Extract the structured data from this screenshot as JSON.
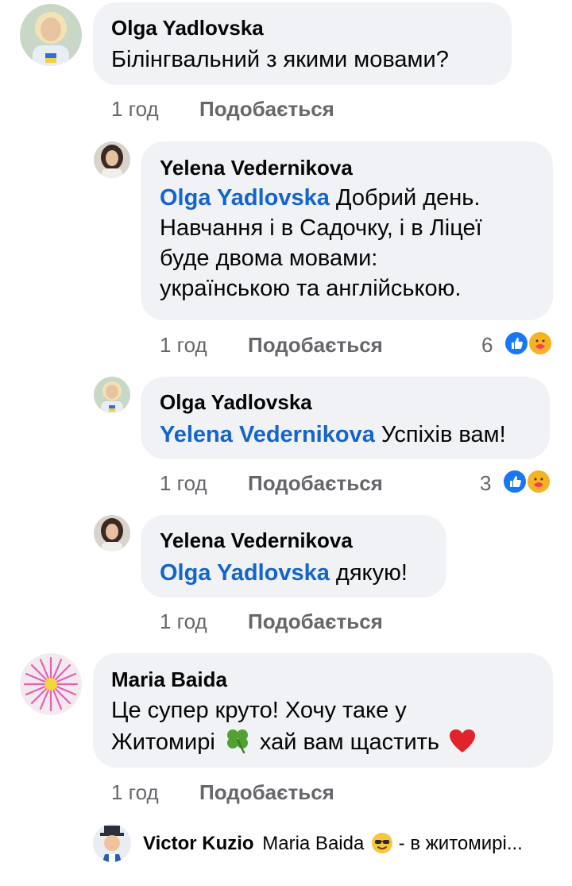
{
  "comments": [
    {
      "author": "Olga  Yadlovska",
      "text": "Білінгвальний з якими мовами?",
      "time": "1 год",
      "like_label": "Подобається"
    },
    {
      "author": "Yelena Vedernikova",
      "mention": "Olga  Yadlovska",
      "text_lines": [
        " Добрий день.",
        "Навчання і в Садочку, і в Ліцеї",
        "буде двома мовами:",
        "українською та англійською."
      ],
      "time": "1 год",
      "like_label": "Подобається",
      "reaction_count": "6"
    },
    {
      "author": "Olga  Yadlovska",
      "mention": "Yelena Vedernikova",
      "text": " Успіхів вам!",
      "time": "1 год",
      "like_label": "Подобається",
      "reaction_count": "3"
    },
    {
      "author": "Yelena Vedernikova",
      "mention": "Olga  Yadlovska",
      "text": " дякую!",
      "time": "1 год",
      "like_label": "Подобається"
    },
    {
      "author": "Maria Baida",
      "text_lines": [
        "Це супер круто! Хочу таке у",
        "Житомирі",
        "хай вам щастить"
      ],
      "time": "1 год",
      "like_label": "Подобається"
    }
  ],
  "reply_preview": {
    "author": "Victor Kuzio",
    "mention": "Maria Baida",
    "text": " - в житомирі..."
  },
  "colors": {
    "bubble": "#f0f2f5",
    "mention": "#1464cc",
    "meta": "#65676b",
    "like_reaction": "#1877f2",
    "care_reaction": "#f7b125"
  },
  "icons": [
    "like-reaction-icon",
    "care-reaction-icon",
    "four-leaf-clover-icon",
    "red-heart-icon",
    "sunglasses-emoji-icon"
  ]
}
